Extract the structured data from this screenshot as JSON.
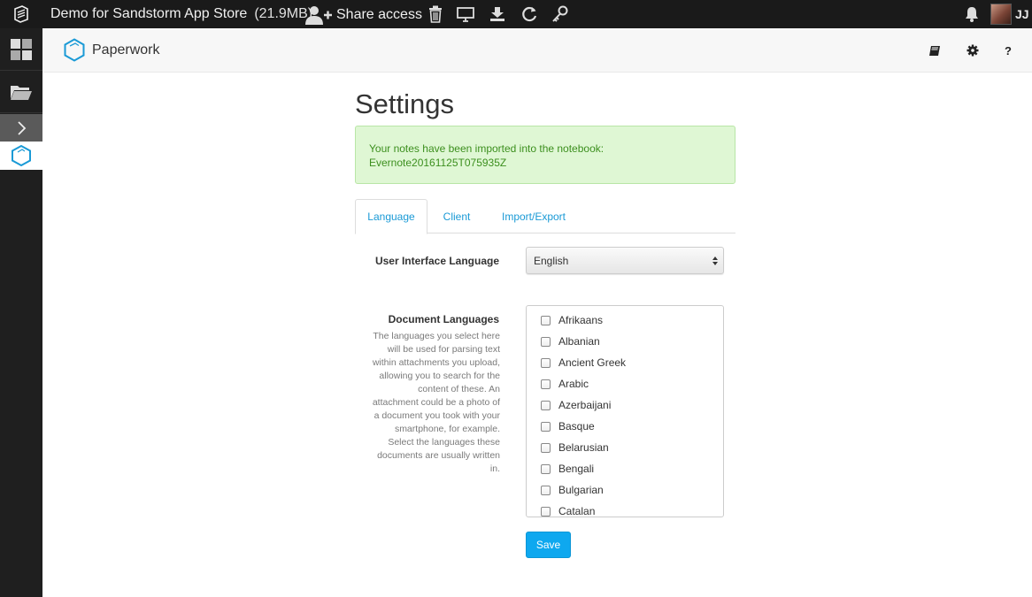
{
  "topbar": {
    "grain_title": "Demo for Sandstorm App Store",
    "grain_size": "(21.9MB)",
    "share_label": "Share access",
    "user_initials": "JJ",
    "icons": [
      "sandstorm-logo-icon",
      "person-plus-icon",
      "trash-icon",
      "monitor-icon",
      "download-icon",
      "refresh-icon",
      "key-icon",
      "bell-icon"
    ]
  },
  "sidebar": {
    "items": [
      "apps-grid-icon",
      "folder-icon",
      "chevron-right-icon",
      "paperwork-cube-icon"
    ]
  },
  "header": {
    "brand": "Paperwork",
    "buttons": [
      "book-icon",
      "gear-icon",
      "help-icon"
    ],
    "help_label": "?"
  },
  "main": {
    "title": "Settings",
    "alert": {
      "line1": "Your notes have been imported into the notebook:",
      "line2": "Evernote20161125T075935Z",
      "color": "#3c8f1e",
      "background": "#dff7d4"
    },
    "tabs": [
      {
        "label": "Language",
        "active": true
      },
      {
        "label": "Client",
        "active": false
      },
      {
        "label": "Import/Export",
        "active": false
      }
    ],
    "ui_language": {
      "label": "User Interface Language",
      "selected": "English"
    },
    "document_languages": {
      "label": "Document Languages",
      "help_lines": [
        "The languages you select here",
        "will be used for parsing text",
        "within attachments you upload,",
        "allowing you to search for the",
        "content of these. An",
        "attachment could be a photo of",
        "a document you took with your",
        "smartphone, for example.",
        "Select the languages these",
        "documents are usually written",
        "in."
      ],
      "options": [
        "Afrikaans",
        "Albanian",
        "Ancient Greek",
        "Arabic",
        "Azerbaijani",
        "Basque",
        "Belarusian",
        "Bengali",
        "Bulgarian",
        "Catalan"
      ]
    },
    "save_label": "Save",
    "accent_color": "#1a9ad6"
  }
}
